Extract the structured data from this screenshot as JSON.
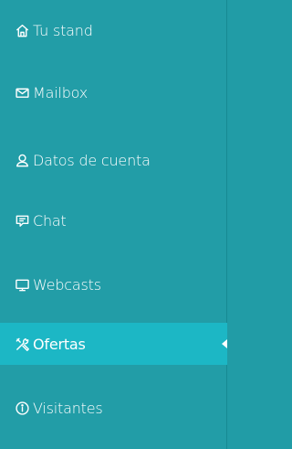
{
  "sidebar": {
    "items": [
      {
        "label": "Tu stand",
        "icon": "home-icon"
      },
      {
        "label": "Mailbox",
        "icon": "mail-icon"
      },
      {
        "label": "Datos de cuenta",
        "icon": "user-icon"
      },
      {
        "label": "Chat",
        "icon": "chat-icon"
      },
      {
        "label": "Webcasts",
        "icon": "monitor-icon"
      },
      {
        "label": "Ofertas",
        "icon": "tools-icon",
        "active": true
      },
      {
        "label": "Visitantes",
        "icon": "info-icon"
      }
    ]
  },
  "colors": {
    "background": "#229da7",
    "active_background": "#1cb7c5",
    "text": "#ffffff"
  }
}
